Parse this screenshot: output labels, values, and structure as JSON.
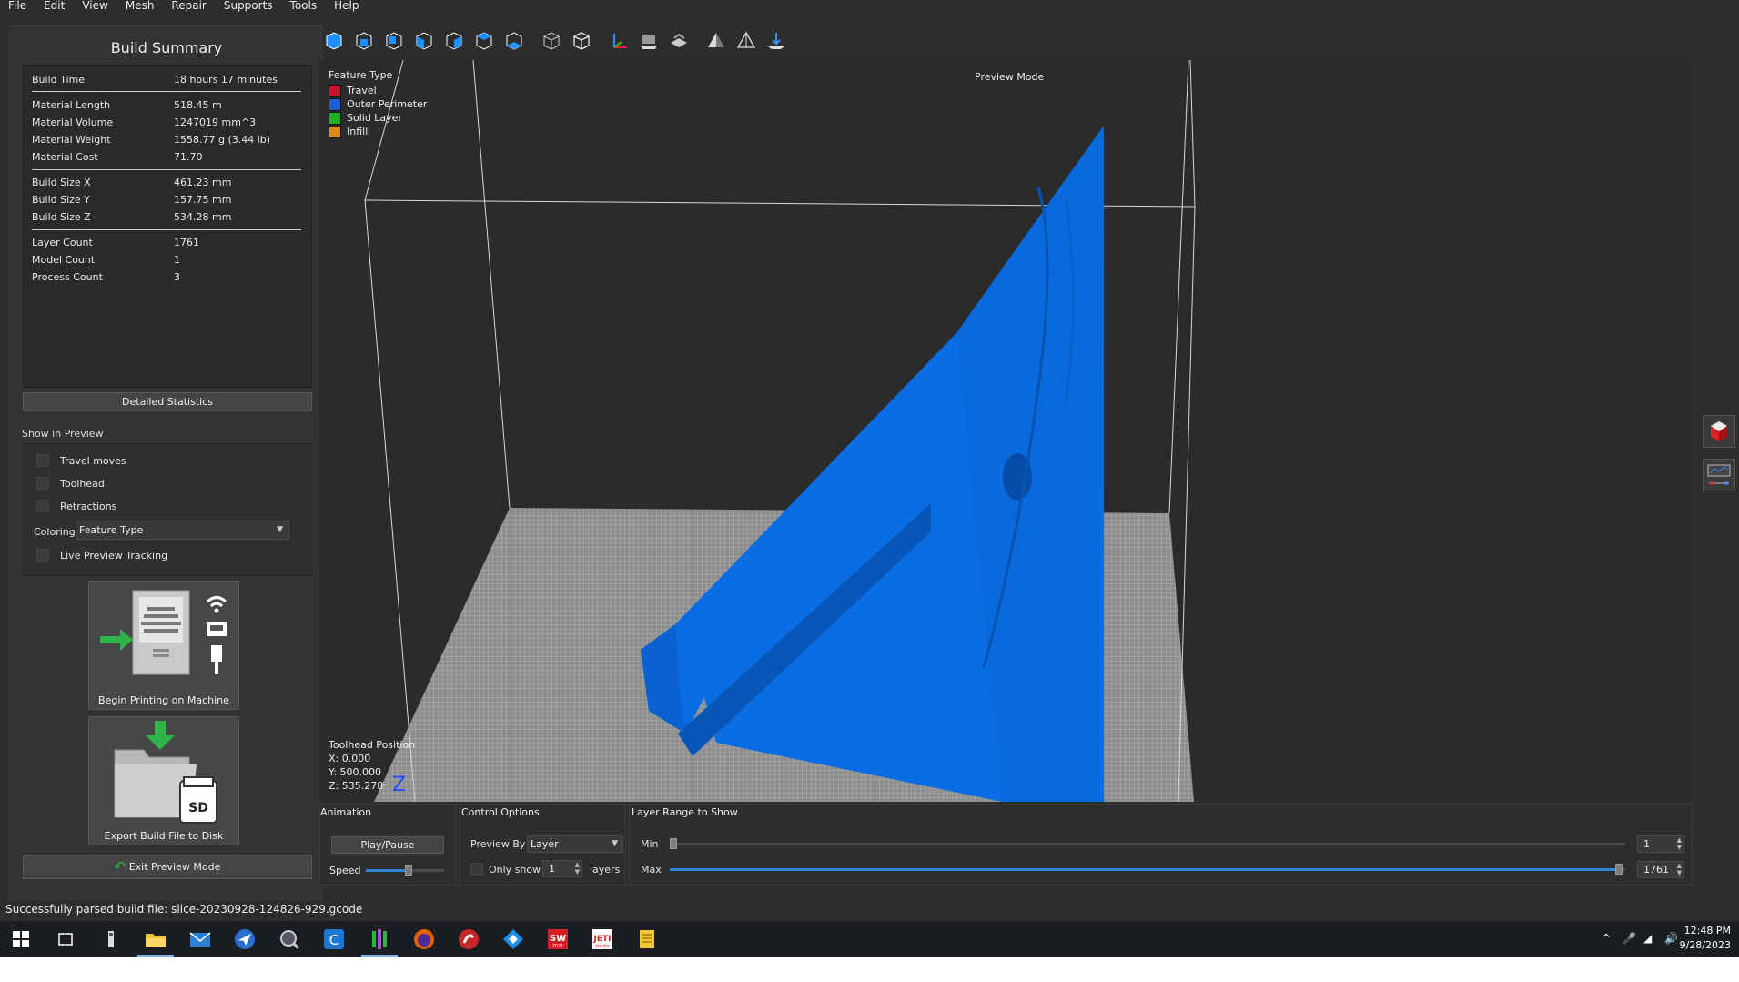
{
  "menu": [
    "File",
    "Edit",
    "View",
    "Mesh",
    "Repair",
    "Supports",
    "Tools",
    "Help"
  ],
  "summary": {
    "title": "Build Summary",
    "rows": [
      {
        "k": "Build Time",
        "v": "18 hours 17 minutes"
      },
      {
        "k": "Material Length",
        "v": "518.45 m"
      },
      {
        "k": "Material Volume",
        "v": "1247019 mm^3"
      },
      {
        "k": "Material Weight",
        "v": "1558.77 g (3.44 lb)"
      },
      {
        "k": "Material Cost",
        "v": "71.70"
      },
      {
        "k": "Build Size X",
        "v": "461.23 mm"
      },
      {
        "k": "Build Size Y",
        "v": "157.75 mm"
      },
      {
        "k": "Build Size Z",
        "v": "534.28 mm"
      },
      {
        "k": "Layer Count",
        "v": "1761"
      },
      {
        "k": "Model Count",
        "v": "1"
      },
      {
        "k": "Process Count",
        "v": "3"
      }
    ],
    "detailed_button": "Detailed Statistics"
  },
  "show_in_preview": {
    "label": "Show in Preview",
    "options": [
      "Travel moves",
      "Toolhead",
      "Retractions"
    ],
    "coloring_label": "Coloring",
    "coloring_value": "Feature Type",
    "live_tracking": "Live Preview Tracking"
  },
  "actions": {
    "begin_printing": "Begin Printing on Machine",
    "export": "Export Build File to Disk",
    "sd_label": "SD",
    "exit_preview": "Exit Preview Mode"
  },
  "viewport": {
    "legend_title": "Feature Type",
    "legend": [
      {
        "name": "Travel",
        "color": "#c8102e"
      },
      {
        "name": "Outer Perimeter",
        "color": "#1f5fd6"
      },
      {
        "name": "Solid Layer",
        "color": "#1db31d"
      },
      {
        "name": "Infill",
        "color": "#d98a12"
      }
    ],
    "mode_label": "Preview Mode",
    "toolhead_title": "Toolhead Position",
    "toolhead_x": "X: 0.000",
    "toolhead_y": "Y: 500.000",
    "toolhead_z": "Z: 535.278",
    "axis_label": "Z",
    "model_color": "#0a6fe6"
  },
  "animation": {
    "title": "Animation",
    "play_label": "Play/Pause",
    "speed_label": "Speed",
    "speed_level": 0.55
  },
  "control": {
    "title": "Control Options",
    "preview_by_label": "Preview By",
    "preview_by_value": "Layer",
    "only_show_label": "Only show",
    "only_show_value": "1",
    "layers_label": "layers"
  },
  "layer_range": {
    "title": "Layer Range to Show",
    "min_label": "Min",
    "min_value": "1",
    "max_label": "Max",
    "max_value": "1761"
  },
  "status": "Successfully parsed build file: slice-20230928-124826-929.gcode",
  "clock": {
    "time": "12:48 PM",
    "date": "9/28/2023"
  }
}
